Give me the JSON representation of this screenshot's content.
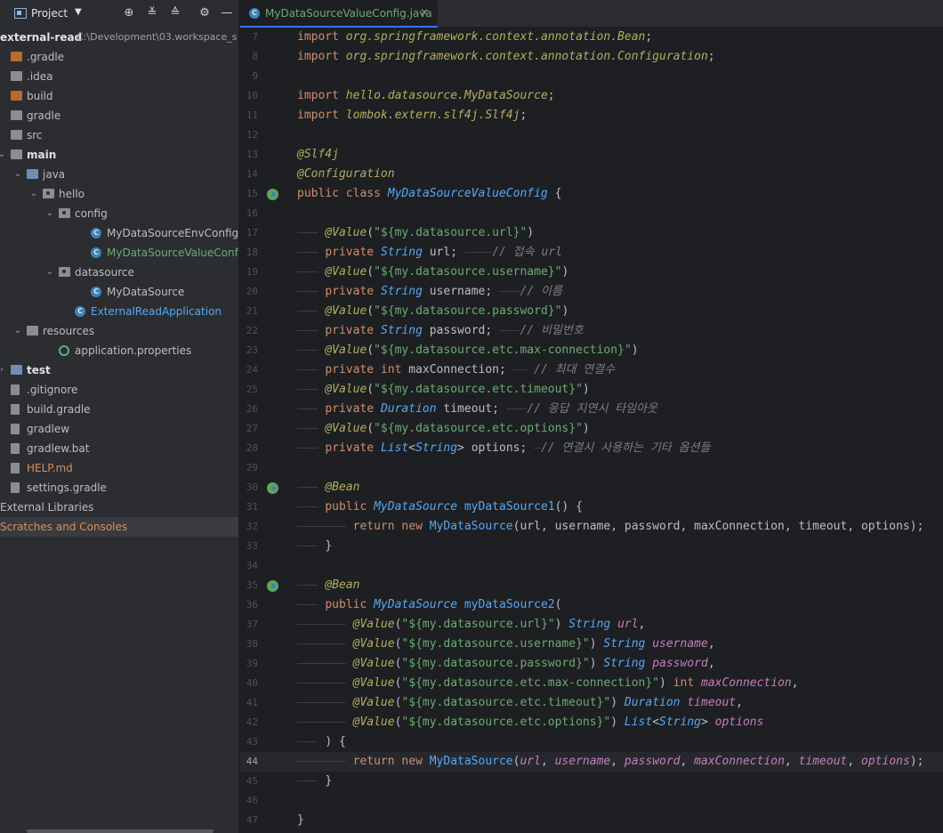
{
  "sidebar": {
    "title": "Project",
    "toolbar_icons": [
      "target-icon",
      "expand-all-icon",
      "collapse-all-icon",
      "gear-icon",
      "minimize-icon"
    ],
    "tree": [
      {
        "label": "external-read",
        "path": "C:\\Development\\03.workspace_s",
        "depth": 0,
        "chev": "",
        "icon": "none",
        "bold": true
      },
      {
        "label": ".gradle",
        "depth": 0,
        "chev": "",
        "icon": "folder-brown"
      },
      {
        "label": ".idea",
        "depth": 0,
        "chev": "",
        "icon": "folder-gray"
      },
      {
        "label": "build",
        "depth": 0,
        "chev": "",
        "icon": "folder-brown"
      },
      {
        "label": "gradle",
        "depth": 0,
        "chev": "",
        "icon": "folder-gray"
      },
      {
        "label": "src",
        "depth": 0,
        "chev": "",
        "icon": "folder-gray"
      },
      {
        "label": "main",
        "depth": 0,
        "chev": "v",
        "icon": "folder-gray",
        "bold": true
      },
      {
        "label": "java",
        "depth": 1,
        "chev": "v",
        "icon": "folder-blue"
      },
      {
        "label": "hello",
        "depth": 2,
        "chev": "v",
        "icon": "folder-pkg"
      },
      {
        "label": "config",
        "depth": 3,
        "chev": "v",
        "icon": "folder-pkg"
      },
      {
        "label": "MyDataSourceEnvConfig",
        "depth": 5,
        "chev": "",
        "icon": "class"
      },
      {
        "label": "MyDataSourceValueConfig",
        "depth": 5,
        "chev": "",
        "icon": "class",
        "style": "green"
      },
      {
        "label": "datasource",
        "depth": 3,
        "chev": "v",
        "icon": "folder-pkg"
      },
      {
        "label": "MyDataSource",
        "depth": 5,
        "chev": "",
        "icon": "class"
      },
      {
        "label": "ExternalReadApplication",
        "depth": 4,
        "chev": "",
        "icon": "class",
        "style": "blue"
      },
      {
        "label": "resources",
        "depth": 1,
        "chev": "v",
        "icon": "folder-gray"
      },
      {
        "label": "application.properties",
        "depth": 3,
        "chev": "",
        "icon": "gear"
      },
      {
        "label": "test",
        "depth": 0,
        "chev": ">",
        "icon": "folder-blue",
        "bold": true
      },
      {
        "label": ".gitignore",
        "depth": 0,
        "chev": "",
        "icon": "file"
      },
      {
        "label": "build.gradle",
        "depth": 0,
        "chev": "",
        "icon": "file"
      },
      {
        "label": "gradlew",
        "depth": 0,
        "chev": "",
        "icon": "file"
      },
      {
        "label": "gradlew.bat",
        "depth": 0,
        "chev": "",
        "icon": "file"
      },
      {
        "label": "HELP.md",
        "depth": 0,
        "chev": "",
        "icon": "file",
        "style": "brown"
      },
      {
        "label": "settings.gradle",
        "depth": 0,
        "chev": "",
        "icon": "file"
      },
      {
        "label": "External Libraries",
        "depth": 0,
        "chev": "",
        "icon": "none"
      },
      {
        "label": "Scratches and Consoles",
        "depth": 0,
        "chev": "",
        "icon": "none",
        "style": "brown",
        "selected": true
      }
    ]
  },
  "editor": {
    "tab_label": "MyDataSourceValueConfig.java",
    "current_line": 44,
    "lines": [
      {
        "n": "7",
        "tokens": [
          [
            "kw",
            "import "
          ],
          [
            "pkg",
            "org.springframework.context.annotation.Bean"
          ],
          [
            "",
            "; "
          ]
        ]
      },
      {
        "n": "8",
        "tokens": [
          [
            "kw",
            "import "
          ],
          [
            "pkg",
            "org.springframework.context.annotation.Configuration"
          ],
          [
            "",
            ";"
          ]
        ]
      },
      {
        "n": "9",
        "tokens": []
      },
      {
        "n": "10",
        "tokens": [
          [
            "kw",
            "import "
          ],
          [
            "pkg",
            "hello.datasource.MyDataSource"
          ],
          [
            "",
            ";"
          ]
        ]
      },
      {
        "n": "11",
        "tokens": [
          [
            "kw",
            "import "
          ],
          [
            "pkg",
            "lombok.extern.slf4j.Slf4j"
          ],
          [
            "",
            ";"
          ]
        ]
      },
      {
        "n": "12",
        "tokens": []
      },
      {
        "n": "13",
        "tokens": [
          [
            "ann",
            "@Slf4j"
          ]
        ]
      },
      {
        "n": "14",
        "tokens": [
          [
            "ann",
            "@Configuration"
          ]
        ]
      },
      {
        "n": "15",
        "gutter": "bean",
        "tokens": [
          [
            "kw",
            "public class "
          ],
          [
            "cls",
            "MyDataSourceValueConfig"
          ],
          [
            "",
            " {"
          ]
        ]
      },
      {
        "n": "16",
        "tokens": []
      },
      {
        "n": "17",
        "indent": 1,
        "tokens": [
          [
            "ann",
            "@Value"
          ],
          [
            "",
            "("
          ],
          [
            "str",
            "\"${my.datasource.url}\""
          ],
          [
            "",
            ")"
          ]
        ]
      },
      {
        "n": "18",
        "indent": 1,
        "tokens": [
          [
            "kw",
            "private "
          ],
          [
            "type",
            "String "
          ],
          [
            "",
            "url; "
          ],
          [
            "ind",
            "————"
          ],
          [
            "cmt",
            "// 접속 url"
          ]
        ]
      },
      {
        "n": "19",
        "indent": 1,
        "tokens": [
          [
            "ann",
            "@Value"
          ],
          [
            "",
            "("
          ],
          [
            "str",
            "\"${my.datasource.username}\""
          ],
          [
            "",
            ")"
          ]
        ]
      },
      {
        "n": "20",
        "indent": 1,
        "tokens": [
          [
            "kw",
            "private "
          ],
          [
            "type",
            "String "
          ],
          [
            "",
            "username; "
          ],
          [
            "ind",
            "———"
          ],
          [
            "cmt",
            "// 이름"
          ]
        ]
      },
      {
        "n": "21",
        "indent": 1,
        "tokens": [
          [
            "ann",
            "@Value"
          ],
          [
            "",
            "("
          ],
          [
            "str",
            "\"${my.datasource.password}\""
          ],
          [
            "",
            ")"
          ]
        ]
      },
      {
        "n": "22",
        "indent": 1,
        "tokens": [
          [
            "kw",
            "private "
          ],
          [
            "type",
            "String "
          ],
          [
            "",
            "password; "
          ],
          [
            "ind",
            "———"
          ],
          [
            "cmt",
            "// 비밀번호"
          ]
        ]
      },
      {
        "n": "23",
        "indent": 1,
        "tokens": [
          [
            "ann",
            "@Value"
          ],
          [
            "",
            "("
          ],
          [
            "str",
            "\"${my.datasource.etc.max-connection}\""
          ],
          [
            "",
            ")"
          ]
        ]
      },
      {
        "n": "24",
        "indent": 1,
        "tokens": [
          [
            "kw",
            "private int "
          ],
          [
            "",
            "maxConnection; "
          ],
          [
            "ind",
            "—— "
          ],
          [
            "cmt",
            "// 최대 연결수"
          ]
        ]
      },
      {
        "n": "25",
        "indent": 1,
        "tokens": [
          [
            "ann",
            "@Value"
          ],
          [
            "",
            "("
          ],
          [
            "str",
            "\"${my.datasource.etc.timeout}\""
          ],
          [
            "",
            ")"
          ]
        ]
      },
      {
        "n": "26",
        "indent": 1,
        "tokens": [
          [
            "kw",
            "private "
          ],
          [
            "type",
            "Duration "
          ],
          [
            "",
            "timeout; "
          ],
          [
            "ind",
            "———"
          ],
          [
            "cmt",
            "// 응답 지연시 타임아웃"
          ]
        ]
      },
      {
        "n": "27",
        "indent": 1,
        "tokens": [
          [
            "ann",
            "@Value"
          ],
          [
            "",
            "("
          ],
          [
            "str",
            "\"${my.datasource.etc.options}\""
          ],
          [
            "",
            ")"
          ]
        ]
      },
      {
        "n": "28",
        "indent": 1,
        "tokens": [
          [
            "kw",
            "private "
          ],
          [
            "type",
            "List"
          ],
          [
            "",
            "<"
          ],
          [
            "type",
            "String"
          ],
          [
            "",
            "> options; "
          ],
          [
            "ind",
            "—"
          ],
          [
            "cmt",
            "// 연결시 사용하는 기타 옵션들"
          ]
        ]
      },
      {
        "n": "29",
        "tokens": []
      },
      {
        "n": "30",
        "indent": 1,
        "gutter": "bean",
        "tokens": [
          [
            "ann",
            "@Bean"
          ]
        ]
      },
      {
        "n": "31",
        "indent": 1,
        "tokens": [
          [
            "kw",
            "public "
          ],
          [
            "cls",
            "MyDataSource "
          ],
          [
            "fn",
            "myDataSource1"
          ],
          [
            "",
            "() {"
          ]
        ]
      },
      {
        "n": "32",
        "indent": 2,
        "tokens": [
          [
            "kw",
            "return new "
          ],
          [
            "ctor",
            "MyDataSource"
          ],
          [
            "",
            "(url, username, password, maxConnection, timeout, options);"
          ]
        ]
      },
      {
        "n": "33",
        "indent": 1,
        "tokens": [
          [
            "",
            "}"
          ]
        ]
      },
      {
        "n": "34",
        "tokens": []
      },
      {
        "n": "35",
        "indent": 1,
        "gutter": "bean",
        "tokens": [
          [
            "ann",
            "@Bean"
          ]
        ]
      },
      {
        "n": "36",
        "indent": 1,
        "tokens": [
          [
            "kw",
            "public "
          ],
          [
            "cls",
            "MyDataSource "
          ],
          [
            "fn",
            "myDataSource2"
          ],
          [
            "",
            "("
          ]
        ]
      },
      {
        "n": "37",
        "indent": 2,
        "tokens": [
          [
            "ann",
            "@Value"
          ],
          [
            "",
            "("
          ],
          [
            "str",
            "\"${my.datasource.url}\""
          ],
          [
            "",
            ") "
          ],
          [
            "type",
            "String "
          ],
          [
            "param",
            "url"
          ],
          [
            "",
            ","
          ]
        ]
      },
      {
        "n": "38",
        "indent": 2,
        "tokens": [
          [
            "ann",
            "@Value"
          ],
          [
            "",
            "("
          ],
          [
            "str",
            "\"${my.datasource.username}\""
          ],
          [
            "",
            ") "
          ],
          [
            "type",
            "String "
          ],
          [
            "param",
            "username"
          ],
          [
            "",
            ","
          ]
        ]
      },
      {
        "n": "39",
        "indent": 2,
        "tokens": [
          [
            "ann",
            "@Value"
          ],
          [
            "",
            "("
          ],
          [
            "str",
            "\"${my.datasource.password}\""
          ],
          [
            "",
            ") "
          ],
          [
            "type",
            "String "
          ],
          [
            "param",
            "password"
          ],
          [
            "",
            ","
          ]
        ]
      },
      {
        "n": "40",
        "indent": 2,
        "tokens": [
          [
            "ann",
            "@Value"
          ],
          [
            "",
            "("
          ],
          [
            "str",
            "\"${my.datasource.etc.max-connection}\""
          ],
          [
            "",
            ") "
          ],
          [
            "kw",
            "int "
          ],
          [
            "param",
            "maxConnection"
          ],
          [
            "",
            ","
          ]
        ]
      },
      {
        "n": "41",
        "indent": 2,
        "tokens": [
          [
            "ann",
            "@Value"
          ],
          [
            "",
            "("
          ],
          [
            "str",
            "\"${my.datasource.etc.timeout}\""
          ],
          [
            "",
            ") "
          ],
          [
            "type",
            "Duration "
          ],
          [
            "param",
            "timeout"
          ],
          [
            "",
            ","
          ]
        ]
      },
      {
        "n": "42",
        "indent": 2,
        "tokens": [
          [
            "ann",
            "@Value"
          ],
          [
            "",
            "("
          ],
          [
            "str",
            "\"${my.datasource.etc.options}\""
          ],
          [
            "",
            ") "
          ],
          [
            "type",
            "List"
          ],
          [
            "",
            "<"
          ],
          [
            "type",
            "String"
          ],
          [
            "",
            "> "
          ],
          [
            "param",
            "options"
          ]
        ]
      },
      {
        "n": "43",
        "indent": 1,
        "tokens": [
          [
            "",
            ") {"
          ]
        ]
      },
      {
        "n": "44",
        "indent": 2,
        "tokens": [
          [
            "kw",
            "return new "
          ],
          [
            "ctor",
            "MyDataSource"
          ],
          [
            "",
            "("
          ],
          [
            "param",
            "url"
          ],
          [
            ", ",
            ""
          ],
          [
            "param",
            "username"
          ],
          [
            "",
            ", "
          ],
          [
            "param",
            "password"
          ],
          [
            "",
            ", "
          ],
          [
            "param",
            "maxConnection"
          ],
          [
            "",
            ", "
          ],
          [
            "param",
            "timeout"
          ],
          [
            "",
            ", "
          ],
          [
            "param",
            "options"
          ],
          [
            "",
            ");"
          ]
        ]
      },
      {
        "n": "45",
        "indent": 1,
        "tokens": [
          [
            "",
            "}"
          ]
        ]
      },
      {
        "n": "46",
        "tokens": []
      },
      {
        "n": "47",
        "tokens": [
          [
            "",
            "}"
          ]
        ]
      }
    ]
  },
  "colors": {
    "sidebar_bg": "#2b2d30",
    "editor_bg": "#1e1f22",
    "keyword": "#cf8e6d",
    "string": "#6aab73",
    "annotation": "#b3ae60",
    "type": "#56a8f5",
    "field": "#c77dbb",
    "comment": "#7a7e85",
    "accent": "#3574f0"
  }
}
